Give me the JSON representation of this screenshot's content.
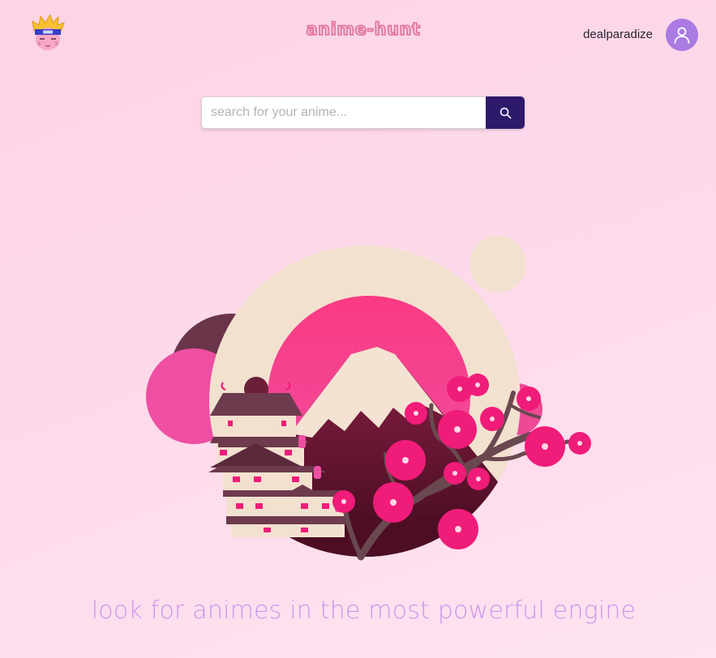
{
  "header": {
    "brand": "anime-hunt",
    "username": "dealparadize"
  },
  "search": {
    "placeholder": "search for your anime...",
    "value": ""
  },
  "hero": {
    "tagline": "look for animes in the most powerful engine"
  },
  "icons": {
    "logo": "ninja-avatar-icon",
    "avatar": "user-icon",
    "search_button": "search-icon"
  },
  "colors": {
    "background": "#fdd6e8",
    "accent": "#a97be3",
    "search_button": "#2e1a6b",
    "tagline": "#cb96ec",
    "brand": "#e0709e"
  }
}
